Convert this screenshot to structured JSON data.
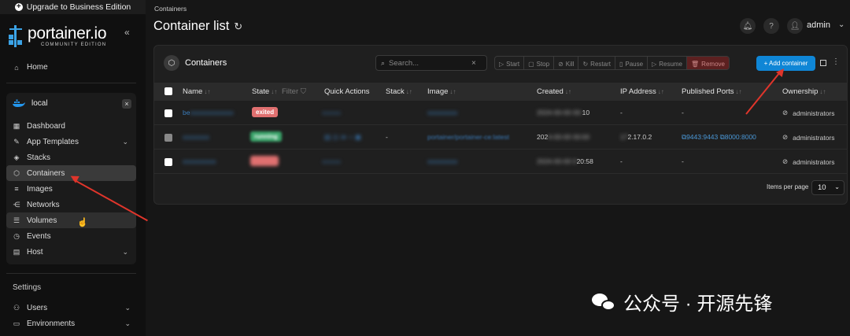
{
  "sidebar": {
    "upgrade_label": "Upgrade to Business Edition",
    "brand": "portainer.io",
    "edition": "COMMUNITY EDITION",
    "collapse_icon": "double-chevron-left-icon",
    "home_label": "Home",
    "environment": {
      "name": "local",
      "close": "×"
    },
    "items": [
      {
        "label": "Dashboard",
        "icon": "dashboard-icon"
      },
      {
        "label": "App Templates",
        "icon": "edit-icon",
        "chevron": true
      },
      {
        "label": "Stacks",
        "icon": "layers-icon"
      },
      {
        "label": "Containers",
        "icon": "cube-icon",
        "active": true
      },
      {
        "label": "Images",
        "icon": "list-icon"
      },
      {
        "label": "Networks",
        "icon": "share-icon"
      },
      {
        "label": "Volumes",
        "icon": "database-icon"
      },
      {
        "label": "Events",
        "icon": "clock-icon"
      },
      {
        "label": "Host",
        "icon": "server-icon",
        "chevron": true
      }
    ],
    "settings_label": "Settings",
    "settings_items": [
      {
        "label": "Users"
      },
      {
        "label": "Environments"
      }
    ]
  },
  "header": {
    "breadcrumb": "Containers",
    "title": "Container list",
    "user": "admin"
  },
  "panel": {
    "title": "Containers",
    "search_placeholder": "Search...",
    "actions": [
      "Start",
      "Stop",
      "Kill",
      "Restart",
      "Pause",
      "Resume",
      "Remove"
    ],
    "add_label": "+ Add container",
    "columns": [
      "Name",
      "State",
      "Filter",
      "Quick Actions",
      "Stack",
      "Image",
      "Created",
      "IP Address",
      "Published Ports",
      "Ownership"
    ],
    "rows": [
      {
        "name": "be",
        "state": "exited",
        "stack": "",
        "image": "",
        "created": "10",
        "ip": "-",
        "ports": "-",
        "ownership": "administrators"
      },
      {
        "name": "",
        "state": "running",
        "stack": "-",
        "image": "portainer/portainer-ce:latest",
        "created": "202",
        "ip": "2.17.0.2",
        "ports": [
          "9443:9443",
          "8000:8000"
        ],
        "ownership": "administrators"
      },
      {
        "name": "",
        "state": "",
        "stack": "",
        "image": "",
        "created": "20:58",
        "ip": "-",
        "ports": "-",
        "ownership": "administrators"
      }
    ],
    "items_per_page_label": "Items per page",
    "items_per_page": "10"
  },
  "watermark": "公众号 · 开源先锋",
  "colors": {
    "accent": "#0f86d6",
    "danger": "#e07070",
    "success": "#3aa46a",
    "arrow": "#e0352b"
  }
}
